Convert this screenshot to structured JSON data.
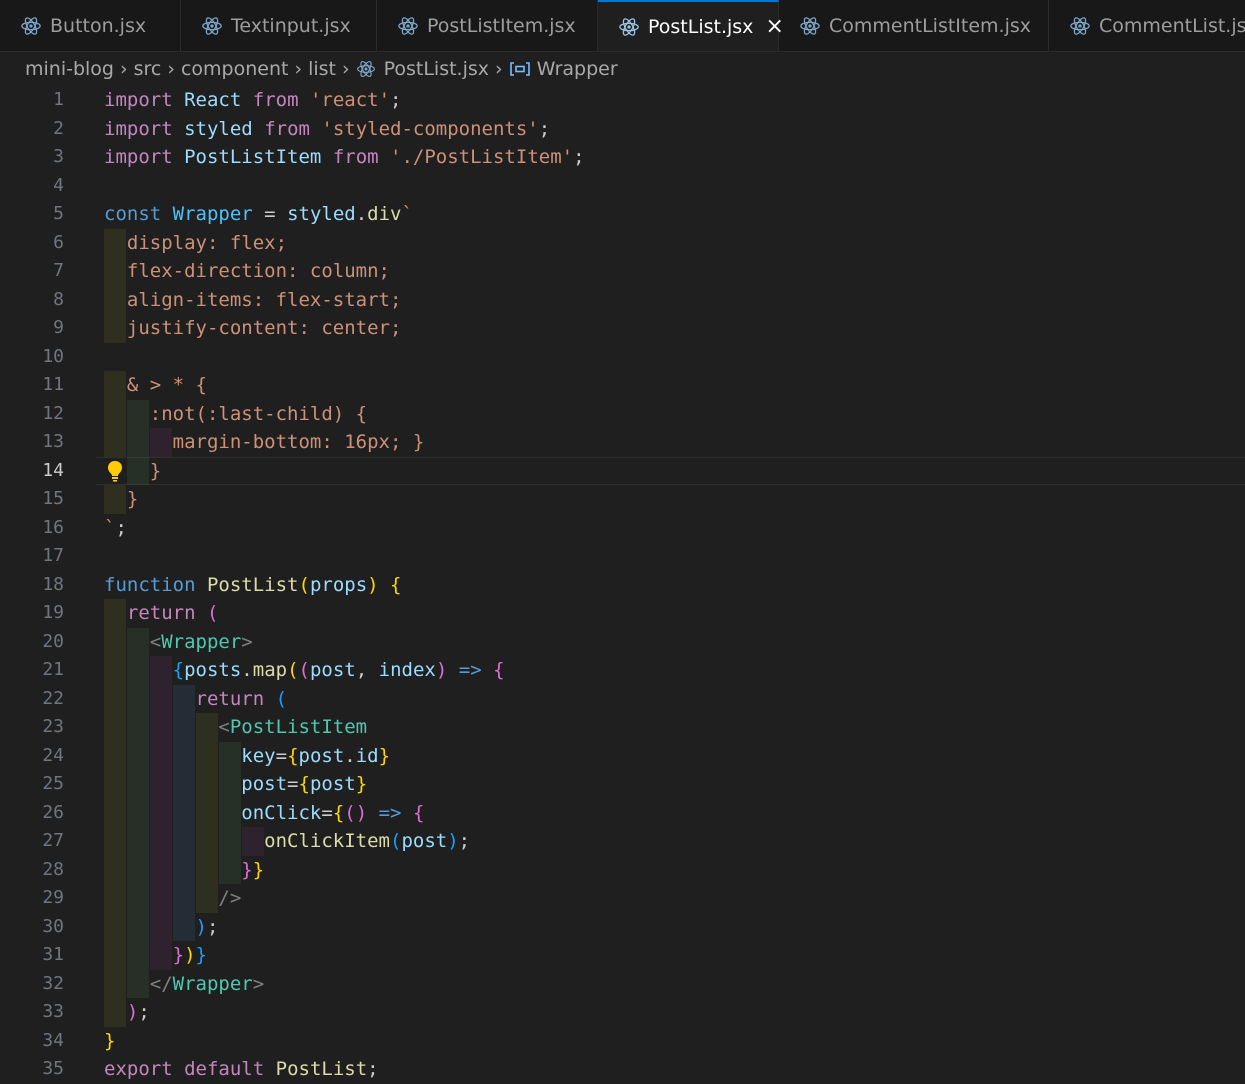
{
  "tabs": [
    {
      "label": "Button.jsx",
      "active": false
    },
    {
      "label": "Textinput.jsx",
      "active": false
    },
    {
      "label": "PostListItem.jsx",
      "active": false
    },
    {
      "label": "PostList.jsx",
      "active": true
    },
    {
      "label": "CommentListItem.jsx",
      "active": false
    },
    {
      "label": "CommentList.jsx",
      "active": false
    }
  ],
  "icons": {
    "tab_file": "react-icon",
    "close": "close-icon",
    "symbol": "symbol-variable-icon",
    "lightbulb": "lightbulb-icon"
  },
  "breadcrumb": {
    "items": [
      "mini-blog",
      "src",
      "component",
      "list"
    ],
    "file": "PostList.jsx",
    "symbol": "Wrapper"
  },
  "editor": {
    "current_line": 14,
    "line_numbers": [
      "1",
      "2",
      "3",
      "4",
      "5",
      "6",
      "7",
      "8",
      "9",
      "10",
      "11",
      "12",
      "13",
      "14",
      "15",
      "16",
      "17",
      "18",
      "19",
      "20",
      "21",
      "22",
      "23",
      "24",
      "25",
      "26",
      "27",
      "28",
      "29",
      "30",
      "31",
      "32",
      "33",
      "34",
      "35"
    ]
  },
  "colors": {
    "accent": "#0078d4",
    "keyword": "#569cd6",
    "control": "#c586c0",
    "string": "#ce9178",
    "component": "#4ec9b0",
    "function": "#dcdcaa",
    "variable": "#9cdcfe",
    "lightbulb": "#ffcc00"
  }
}
